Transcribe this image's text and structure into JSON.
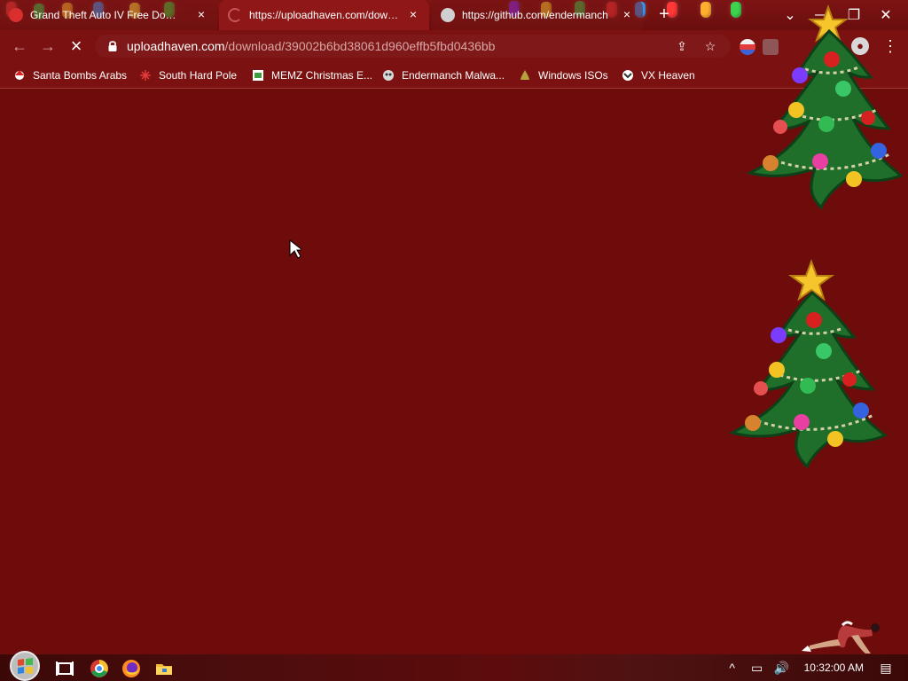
{
  "browser": {
    "tabs": [
      {
        "title": "Grand Theft Auto IV Free Downlo",
        "close_label": "×"
      },
      {
        "title": "https://uploadhaven.com/downlo",
        "close_label": "×"
      },
      {
        "title": "https://github.com/endermanch",
        "close_label": "×"
      }
    ],
    "new_tab_label": "+",
    "window_controls": {
      "dropdown_label": "⌄",
      "minimize_label": "—",
      "maximize_label": "❐",
      "close_label": "✕"
    },
    "toolbar": {
      "back_label": "←",
      "forward_label": "→",
      "reload_label": "×",
      "url_host": "uploadhaven.com",
      "url_path": "/download/39002b6bd38061d960effb5fbd0436bb",
      "share_label": "⇪",
      "star_label": "☆",
      "profile_label": "●",
      "menu_label": "⋮"
    },
    "bookmarks": [
      "Santa Bombs Arabs",
      "South Hard Pole",
      "MEMZ Christmas E...",
      "Endermanch Malwa...",
      "Windows ISOs",
      "VX Heaven"
    ]
  },
  "taskbar": {
    "clock": "10:32:00 AM",
    "tray": {
      "chevron_label": "^",
      "network_label": "▭",
      "volume_label": "🔊",
      "notifications_label": "▤"
    }
  },
  "icons": {
    "tab_1": "game-favicon-icon",
    "tab_2": "loading-favicon-icon",
    "tab_3": "github-favicon-icon",
    "santa_bookmark": "santa-icon",
    "south_bookmark": "snowflake-icon",
    "memz_bookmark": "memz-icon",
    "endermanch_bookmark": "owl-icon",
    "windows_bookmark": "windows-iso-icon",
    "vx_bookmark": "vx-heaven-icon"
  },
  "colors": {
    "page_background": "#6e0b0b",
    "browser_frame": "#7b1111",
    "active_tab": "#8f1717",
    "tree_green": "#1f6f2a",
    "ornament_red": "#d72020",
    "ornament_gold": "#f3c323",
    "taskbar_dark": "#3b0808"
  }
}
